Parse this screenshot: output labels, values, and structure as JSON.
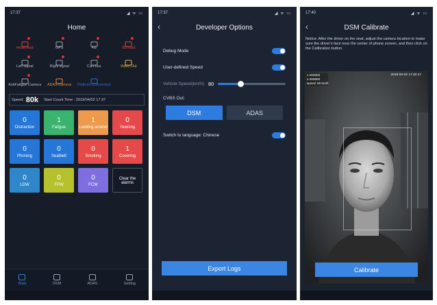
{
  "colors": {
    "accent": "#2f7ce0",
    "alert_red": "#e0322a",
    "phone_bg": "#161c28"
  },
  "screen1": {
    "status_time": "17:37",
    "status_icons": "◢ ᯤ ▭",
    "title": "Home",
    "icons": [
      {
        "label": "Head lead",
        "color": "red",
        "icon": "head-icon"
      },
      {
        "label": "GPS",
        "color": "gray",
        "icon": "gps-icon"
      },
      {
        "label": "4G",
        "color": "gray",
        "icon": "signal-icon"
      },
      {
        "label": "SD card",
        "color": "red",
        "icon": "sdcard-icon"
      },
      {
        "label": "Left signal",
        "color": "gray",
        "icon": "left-signal-icon"
      },
      {
        "label": "Right signal",
        "color": "gray",
        "icon": "right-signal-icon"
      },
      {
        "label": "Can-bus",
        "color": "gray",
        "icon": "canbus-icon"
      },
      {
        "label": "Video Out",
        "color": "yellow",
        "icon": "video-out-icon"
      },
      {
        "label": "AntiFatigue Camera",
        "color": "gray",
        "icon": "camera-icon"
      },
      {
        "label": "ADAS Camera",
        "color": "orange",
        "icon": "adas-camera-icon"
      },
      {
        "label": "Platform Connection",
        "color": "blue",
        "icon": "platform-icon"
      }
    ],
    "speed_label": "Speed:",
    "speed_value": "80k",
    "start_label": "Start Count Time : 2019/04/02 17:37",
    "tiles": [
      {
        "num": "0",
        "label": "Distraction",
        "color": "blue"
      },
      {
        "num": "1",
        "label": "Fatigue",
        "color": "green"
      },
      {
        "num": "1",
        "label": "Looking around",
        "color": "orange"
      },
      {
        "num": "0",
        "label": "Yawning",
        "color": "red"
      },
      {
        "num": "0",
        "label": "Phoning",
        "color": "blue"
      },
      {
        "num": "0",
        "label": "Seatbelt",
        "color": "blue"
      },
      {
        "num": "0",
        "label": "Smoking",
        "color": "red"
      },
      {
        "num": "1",
        "label": "Covering",
        "color": "red"
      },
      {
        "num": "0",
        "label": "LDW",
        "color": "lblue"
      },
      {
        "num": "0",
        "label": "FPW",
        "color": "lime"
      },
      {
        "num": "0",
        "label": "FCW",
        "color": "purple"
      },
      {
        "num": "",
        "label": "Clear the alarms",
        "color": "clear"
      }
    ],
    "nav": [
      {
        "label": "Stats",
        "active": true
      },
      {
        "label": "DSM",
        "active": false
      },
      {
        "label": "ADAS",
        "active": false
      },
      {
        "label": "Setting",
        "active": false
      }
    ]
  },
  "screen2": {
    "status_time": "17:37",
    "status_icons": "◢ ᯤ ▭",
    "back": "‹",
    "title": "Developer Options",
    "debug_label": "Debug Mode",
    "user_speed_label": "User-defined Speed",
    "vehicle_speed_label": "Vehicle Speed(km/h)",
    "vehicle_speed_value": "80",
    "vehicle_speed_fraction": 0.33,
    "cvbs_label": "CVBS Out:",
    "seg_selected": "DSM",
    "seg_other": "ADAS",
    "language_label": "Switch to language: Chinese",
    "export_label": "Export Logs"
  },
  "screen3": {
    "status_time": "17:40",
    "status_icons": "◢ ᯤ ▭",
    "back": "‹",
    "title": "DSM Calibrate",
    "notice": "Notice: After the driver on the seat, adjust the camera location to make sure the driver's face near the center of phone screen, and then click on the Calibration button.",
    "cam_line1": "1.000000",
    "cam_line2": "1.000000",
    "cam_line3": "speed: 80 km/h",
    "cam_date": "2019-04-02 17:40:17",
    "calibrate_label": "Calibrate"
  }
}
